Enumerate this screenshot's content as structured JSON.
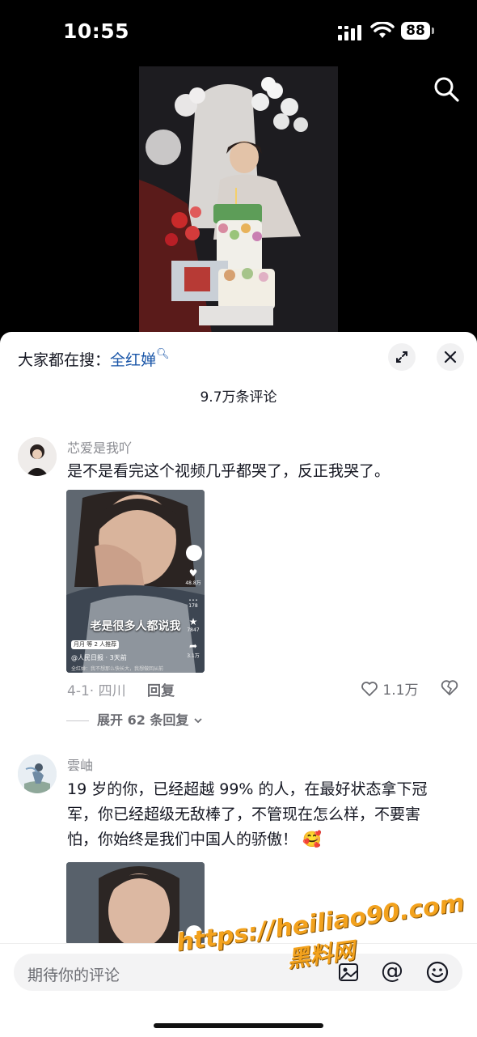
{
  "status_bar": {
    "time": "10:55",
    "battery": "88"
  },
  "header": {
    "hot_search_prefix": "大家都在搜：",
    "hot_search_keyword": "全红婵"
  },
  "comments_count": "9.7万条评论",
  "comments": [
    {
      "user": "芯爱是我吖",
      "text": "是不是看完这个视频几乎都哭了，反正我哭了。",
      "image": {
        "caption": "老是很多人都说我",
        "source": "@人民日报",
        "time": "3天前",
        "recommend": "月月 等 2 人推荐",
        "sub_text": "全红婵：我不想那么快长大，我想做回从前",
        "likes": "48.8万",
        "comments": "178",
        "favorites": "7847",
        "shares": "3.1万"
      },
      "meta": "4-1· 四川",
      "reply_label": "回复",
      "likes": "1.1万",
      "expand_label": "展开 62 条回复"
    },
    {
      "user": "雲岫",
      "text_lines": [
        "19 岁的你，已经超越 99% 的人，在最好状态拿下冠",
        "军，你已经超级无敌棒了，不管现在怎么样，不要害",
        "怕，你始终是我们中国人的骄傲！"
      ]
    }
  ],
  "input": {
    "placeholder": "期待你的评论"
  },
  "watermark": {
    "line1": "https://heiliao90.com",
    "line2": "黑料网"
  }
}
